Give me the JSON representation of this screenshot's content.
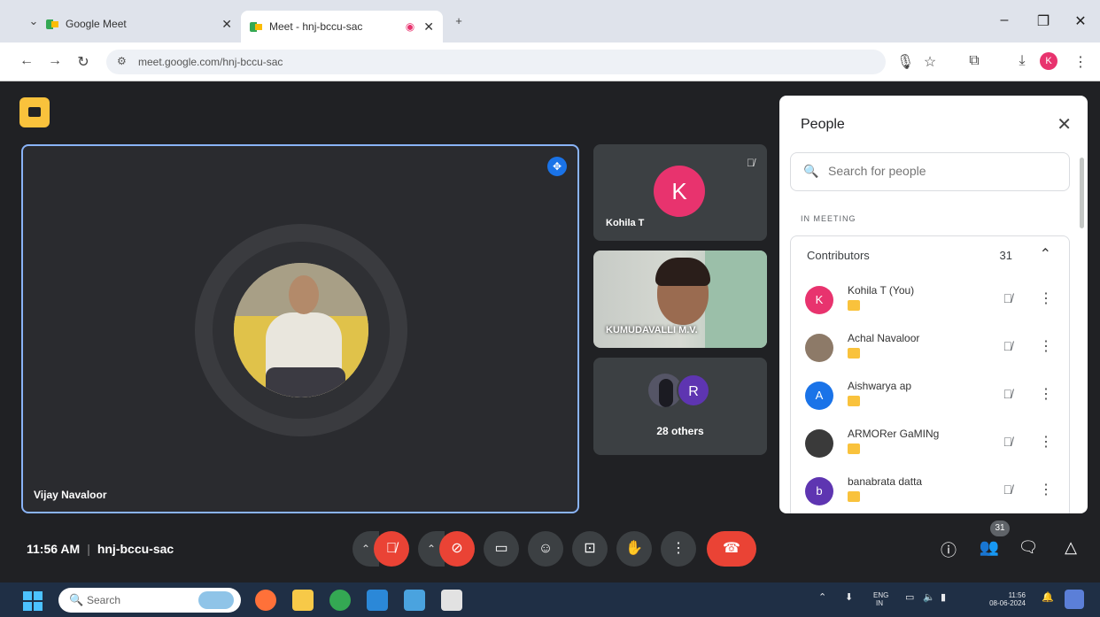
{
  "browser": {
    "tabs": [
      {
        "title": "Google Meet"
      },
      {
        "title": "Meet - hnj-bccu-sac"
      }
    ],
    "url": "meet.google.com/hnj-bccu-sac",
    "profile_initial": "K"
  },
  "meeting": {
    "time": "11:56 AM",
    "code": "hnj-bccu-sac",
    "main_tile_name": "Vijay Navaloor",
    "tiles": [
      {
        "name": "Kohila T",
        "initial": "K"
      },
      {
        "name": "KUMUDAVALLI M.V."
      },
      {
        "others_label": "28 others",
        "initial": "R"
      }
    ],
    "people_badge_count": "31"
  },
  "people_panel": {
    "title": "People",
    "search_placeholder": "Search for people",
    "section_label": "IN MEETING",
    "group_label": "Contributors",
    "group_count": "31",
    "participants": [
      {
        "name": "Kohila T (You)",
        "initial": "K",
        "color": "#e8336e"
      },
      {
        "name": "Achal Navaloor",
        "initial": "",
        "color": "#8d7a68"
      },
      {
        "name": "Aishwarya ap",
        "initial": "A",
        "color": "#1a73e8"
      },
      {
        "name": "ARMORer GaMINg",
        "initial": "",
        "color": "#3a3a3a"
      },
      {
        "name": "banabrata datta",
        "initial": "b",
        "color": "#5e35b1"
      }
    ]
  },
  "taskbar": {
    "search_label": "Search",
    "lang_line1": "ENG",
    "lang_line2": "IN",
    "clock_time": "11:56",
    "clock_date": "08-06-2024"
  },
  "colors": {
    "accent": "#1a73e8",
    "danger": "#ea4335",
    "background": "#202124"
  }
}
